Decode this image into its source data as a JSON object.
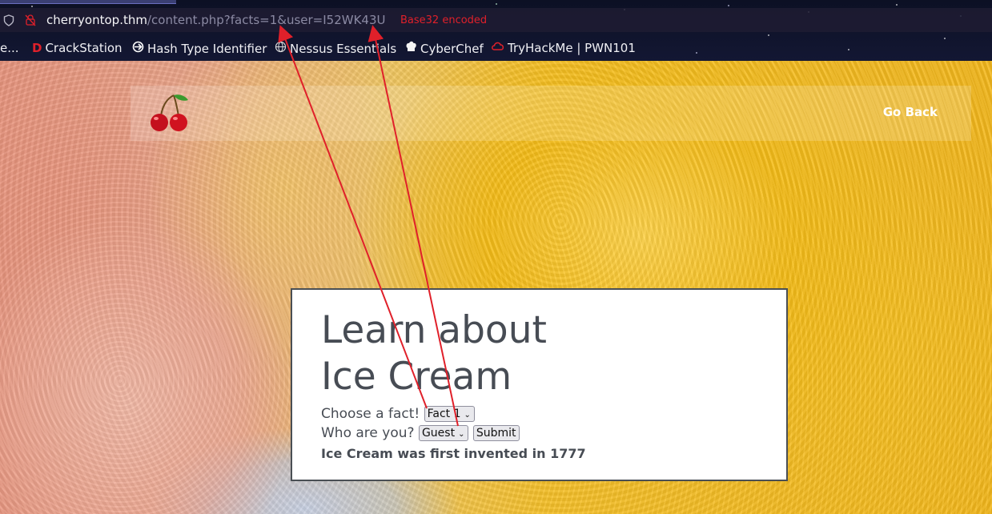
{
  "browser": {
    "url_host": "cherryontop.thm",
    "url_path": "/content.php?facts=1&user=I52WK43U",
    "annotation": "Base32 encoded"
  },
  "bookmarks": [
    {
      "label": "e...",
      "icon": "truncated-bookmark"
    },
    {
      "label": "CrackStation",
      "icon": "crackstation-d-icon"
    },
    {
      "label": "Hash Type Identifier",
      "icon": "hash-identifier-icon"
    },
    {
      "label": "Nessus Essentials",
      "icon": "globe-icon"
    },
    {
      "label": "CyberChef",
      "icon": "cyberchef-icon"
    },
    {
      "label": "TryHackMe | PWN101",
      "icon": "tryhackme-icon"
    }
  ],
  "navbar": {
    "logo": "cherry-icon",
    "go_back": "Go Back"
  },
  "card": {
    "title_line1": "Learn about",
    "title_line2": "Ice Cream",
    "fact_label": "Choose a fact!",
    "fact_selected": "Fact 1",
    "user_label": "Who are you?",
    "user_selected": "Guest",
    "submit": "Submit",
    "result": "Ice Cream was first invented in 1777"
  },
  "colors": {
    "annotation_red": "#e0202a",
    "text_gray": "#474c54"
  }
}
